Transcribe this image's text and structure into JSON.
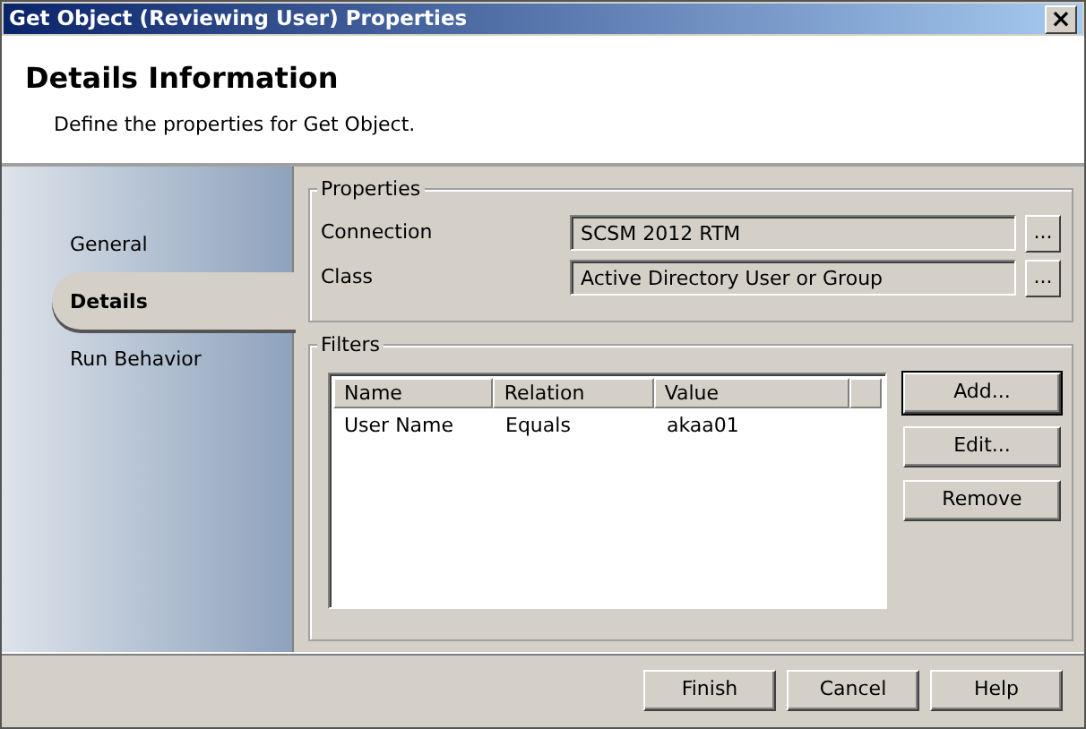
{
  "window": {
    "title": "Get Object (Reviewing User) Properties",
    "close": "×"
  },
  "header": {
    "title": "Details Information",
    "subtitle": "Define the properties for Get Object."
  },
  "nav": [
    {
      "label": "General",
      "selected": false
    },
    {
      "label": "Details",
      "selected": true
    },
    {
      "label": "Run Behavior",
      "selected": false
    }
  ],
  "properties": {
    "legend": "Properties",
    "fields": [
      {
        "label": "Connection",
        "value": "SCSM 2012 RTM",
        "button": "..."
      },
      {
        "label": "Class",
        "value": "Active Directory User or Group",
        "button": "..."
      }
    ]
  },
  "filters": {
    "legend": "Filters",
    "columns": [
      "Name",
      "Relation",
      "Value"
    ],
    "rows": [
      [
        "User Name",
        "Equals",
        "akaa01"
      ]
    ],
    "buttons": [
      {
        "label": "Add...",
        "default": true
      },
      {
        "label": "Edit...",
        "default": false
      },
      {
        "label": "Remove",
        "default": false
      }
    ]
  },
  "footer_buttons": [
    "Finish",
    "Cancel",
    "Help"
  ]
}
